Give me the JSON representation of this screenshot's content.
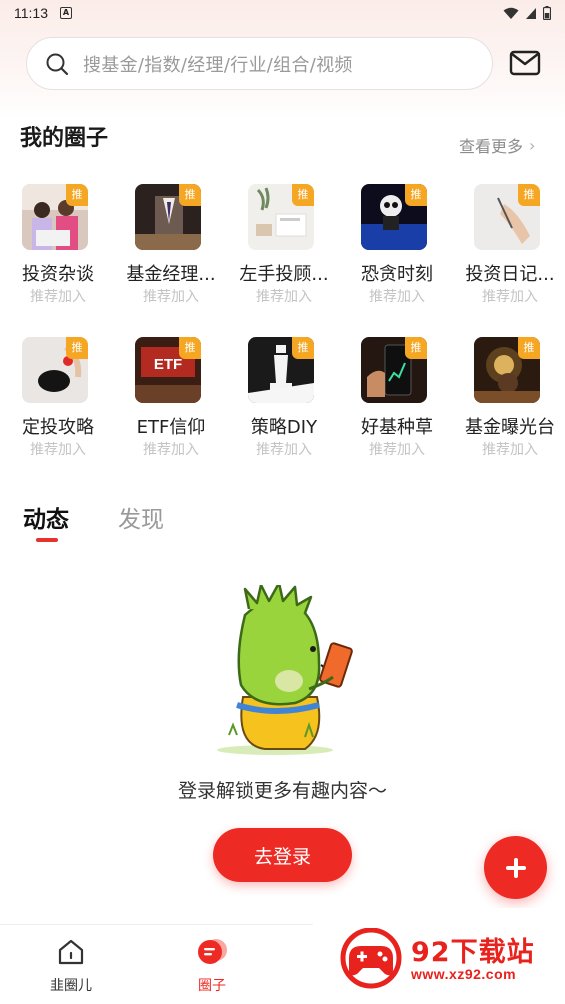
{
  "status_bar": {
    "time": "11:13",
    "app_indicator": "A"
  },
  "search": {
    "placeholder": "搜基金/指数/经理/行业/组合/视频"
  },
  "my_circles": {
    "title": "我的圈子",
    "more_label": "查看更多",
    "badge_label": "推",
    "join_label": "推荐加入",
    "items": [
      {
        "name": "投资杂谈",
        "thumb": "people-laptop"
      },
      {
        "name": "基金经理...",
        "thumb": "suit"
      },
      {
        "name": "左手投顾...",
        "thumb": "desk"
      },
      {
        "name": "恐贪时刻",
        "thumb": "dark-figure"
      },
      {
        "name": "投资日记...",
        "thumb": "writing-hand"
      },
      {
        "name": "定投攻略",
        "thumb": "piggy-bank"
      },
      {
        "name": "ETF信仰",
        "thumb": "etf-screen"
      },
      {
        "name": "策略DIY",
        "thumb": "chess"
      },
      {
        "name": "好基种草",
        "thumb": "phone-chart"
      },
      {
        "name": "基金曝光台",
        "thumb": "sparkler"
      }
    ],
    "etf_thumb_text": "ETF"
  },
  "tabs": [
    {
      "label": "动态",
      "active": true
    },
    {
      "label": "发现",
      "active": false
    }
  ],
  "empty_state": {
    "message": "登录解锁更多有趣内容～",
    "login_button": "去登录"
  },
  "fab": {
    "icon": "plus-icon"
  },
  "bottom_nav": [
    {
      "label": "韭圈儿",
      "icon": "home-icon",
      "active": false
    },
    {
      "label": "圈子",
      "icon": "circle-chat-icon",
      "active": true
    }
  ],
  "watermark": {
    "title": "92下载站",
    "url": "www.xz92.com"
  },
  "colors": {
    "accent": "#ee2a24",
    "badge": "#f5a623",
    "muted": "#c4c4c4"
  }
}
